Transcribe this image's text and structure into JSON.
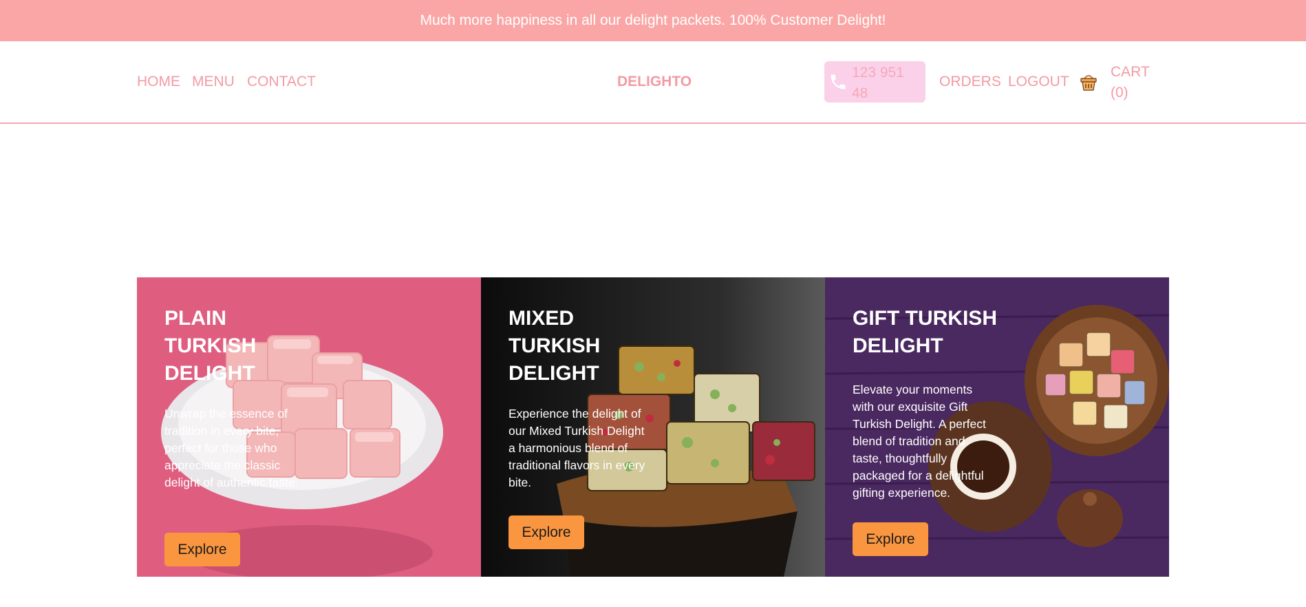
{
  "announcement": {
    "text": "Much more happiness in all our delight packets. 100% Customer Delight!"
  },
  "nav": {
    "links": [
      "HOME",
      "MENU",
      "CONTACT"
    ],
    "brand": "DELIGHTO",
    "phone": "123 951 48",
    "orders": "ORDERS",
    "logout": "LOGOUT",
    "cart": "CART (0)"
  },
  "cards": [
    {
      "title": "PLAIN TURKISH DELIGHT",
      "description": "Unwrap the essence of tradition in every bite, perfect for those who appreciate the classic delight of authentic taste.",
      "button": "Explore"
    },
    {
      "title": "MIXED TURKISH DELIGHT",
      "description": "Experience the delight of our Mixed Turkish Delight a harmonious blend of traditional flavors in every bite.",
      "button": "Explore"
    },
    {
      "title": "GIFT TURKISH DELIGHT",
      "description": "Elevate your moments with our exquisite Gift Turkish Delight. A perfect blend of tradition and taste, thoughtfully packaged for a delightful gifting experience.",
      "button": "Explore"
    }
  ],
  "colors": {
    "announcement_bg": "#fba6a6",
    "nav_accent": "#f39aa4",
    "phone_pill_bg": "#fbd1ea",
    "button_bg": "#fa963f",
    "card1_bg": "#df5e80",
    "card2_bg": "#121212",
    "card3_bg": "#4a2860"
  },
  "icons": [
    "phone-icon",
    "shopping-basket-icon"
  ]
}
